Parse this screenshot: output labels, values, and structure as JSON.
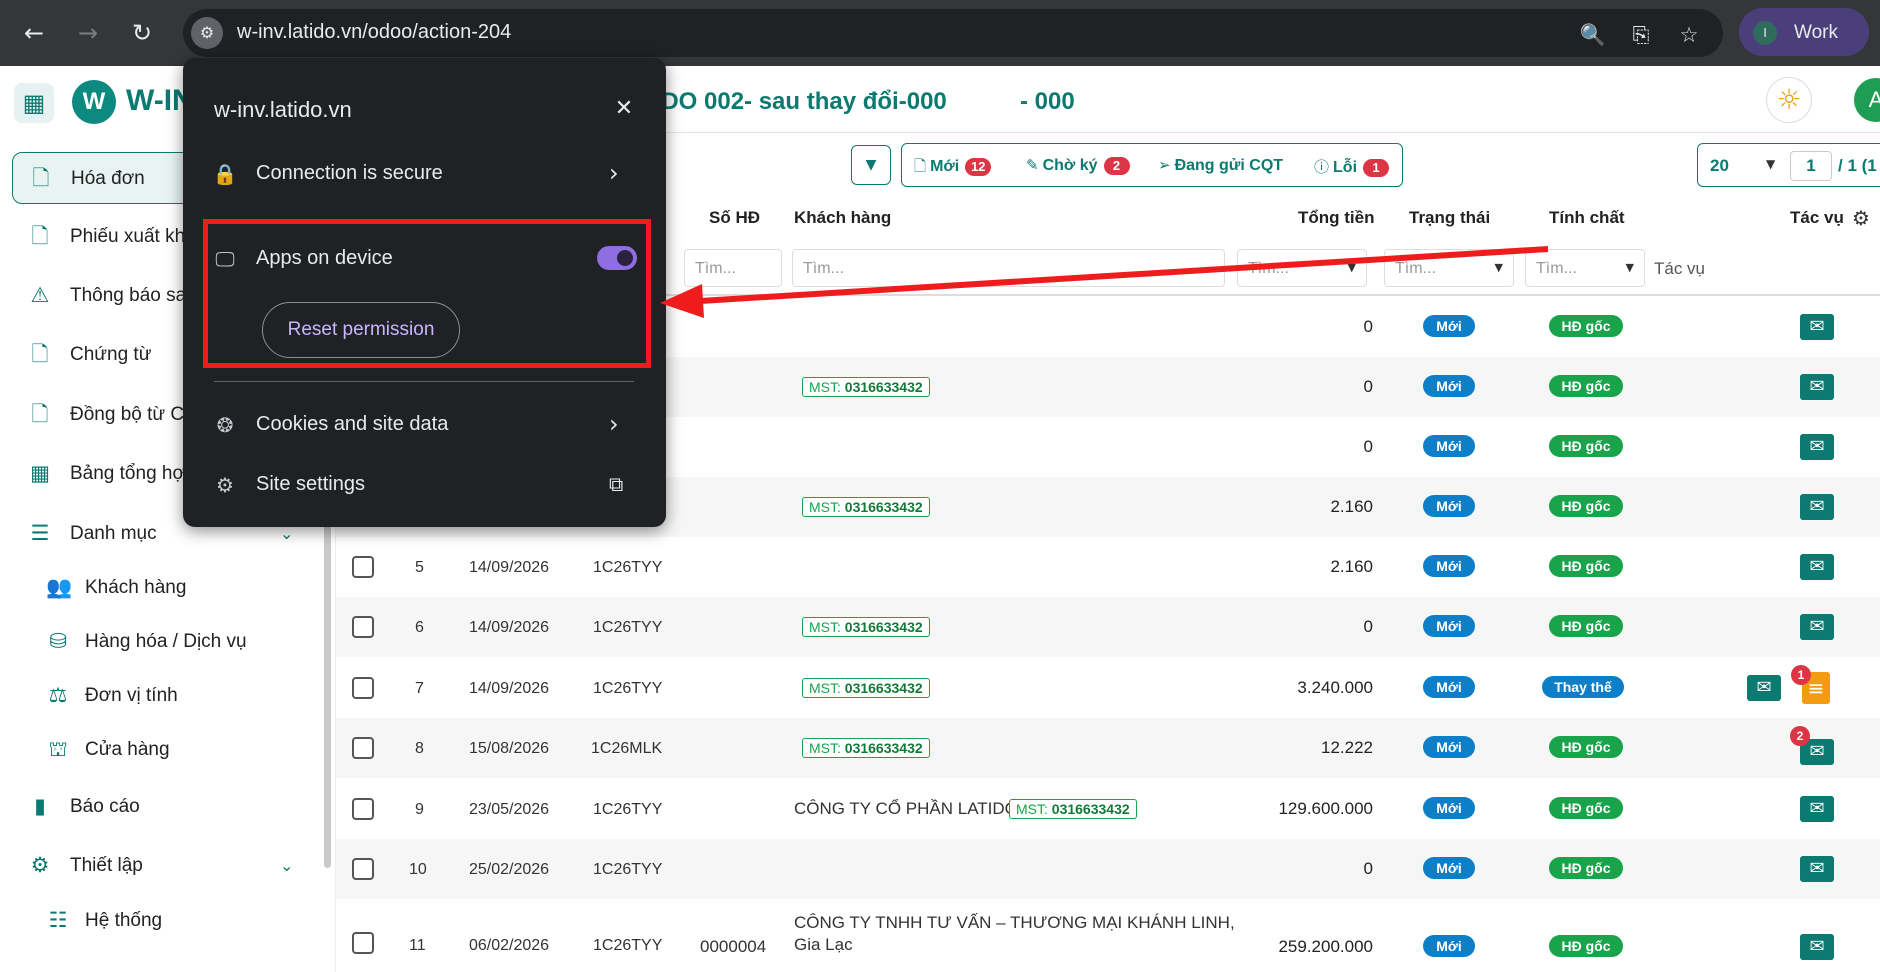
{
  "browser": {
    "url": "w-inv.latido.vn/odoo/action-204",
    "profile_initial": "I",
    "profile_label": "Work"
  },
  "app": {
    "brand": "W-IN",
    "document_title": "TIDO 002- sau thay đổi-000",
    "document_code": "- 000",
    "user_initial": "A"
  },
  "sidebar": {
    "items": [
      {
        "label": "Hóa đơn",
        "icon": "document-icon"
      },
      {
        "label": "Phiếu xuất kh",
        "icon": "document-icon"
      },
      {
        "label": "Thông báo sa",
        "icon": "warning-icon"
      },
      {
        "label": "Chứng từ",
        "icon": "document-icon"
      },
      {
        "label": "Đồng bộ từ C",
        "icon": "document-icon"
      },
      {
        "label": "Bảng tổng hợ",
        "icon": "table-icon"
      },
      {
        "label": "Danh mục",
        "icon": "list-icon"
      },
      {
        "label": "Khách hàng",
        "icon": "users-icon"
      },
      {
        "label": "Hàng hóa / Dịch vụ",
        "icon": "cubes-icon"
      },
      {
        "label": "Đơn vị tính",
        "icon": "scale-icon"
      },
      {
        "label": "Cửa hàng",
        "icon": "basket-icon"
      },
      {
        "label": "Báo cáo",
        "icon": "bar-chart-icon"
      },
      {
        "label": "Thiết lập",
        "icon": "gears-icon"
      },
      {
        "label": "Hệ thống",
        "icon": "sliders-icon"
      }
    ]
  },
  "filters": [
    {
      "label": "Mới",
      "count": "12"
    },
    {
      "label": "Chờ ký",
      "count": "2"
    },
    {
      "label": "Đang gửi CQT",
      "count": ""
    },
    {
      "label": "Lỗi",
      "count": "1"
    }
  ],
  "pager": {
    "size": "20",
    "page": "1",
    "total": "/ 1 (1"
  },
  "table": {
    "headers": {
      "invoice_no": "Số HĐ",
      "customer": "Khách hàng",
      "total": "Tổng tiền",
      "status": "Trạng thái",
      "nature": "Tính chất",
      "actions": "Tác vụ"
    },
    "search_placeholder": "Tìm...",
    "actions_filter_label": "Tác vụ",
    "rows": [
      {
        "no": "",
        "date": "",
        "series": "",
        "invoice_no": "",
        "customer": "",
        "mst": "",
        "total": "0",
        "status": "Mới",
        "nature": "HĐ gốc"
      },
      {
        "no": "",
        "date": "",
        "series": "",
        "invoice_no": "",
        "customer": "",
        "mst": "0316633432",
        "total": "0",
        "status": "Mới",
        "nature": "HĐ gốc"
      },
      {
        "no": "",
        "date": "",
        "series": "",
        "invoice_no": "",
        "customer": "",
        "mst": "",
        "total": "0",
        "status": "Mới",
        "nature": "HĐ gốc"
      },
      {
        "no": "",
        "date": "",
        "series": "",
        "invoice_no": "",
        "customer": "",
        "mst": "0316633432",
        "total": "2.160",
        "status": "Mới",
        "nature": "HĐ gốc"
      },
      {
        "no": "5",
        "date": "14/09/2026",
        "series": "1C26TYY",
        "invoice_no": "",
        "customer": "",
        "mst": "",
        "total": "2.160",
        "status": "Mới",
        "nature": "HĐ gốc"
      },
      {
        "no": "6",
        "date": "14/09/2026",
        "series": "1C26TYY",
        "invoice_no": "",
        "customer": "",
        "mst": "0316633432",
        "total": "0",
        "status": "Mới",
        "nature": "HĐ gốc"
      },
      {
        "no": "7",
        "date": "14/09/2026",
        "series": "1C26TYY",
        "invoice_no": "",
        "customer": "",
        "mst": "0316633432",
        "total": "3.240.000",
        "status": "Mới",
        "nature": "Thay thế",
        "doc_badge": "1"
      },
      {
        "no": "8",
        "date": "15/08/2026",
        "series": "1C26MLK",
        "invoice_no": "",
        "customer": "",
        "mst": "0316633432",
        "total": "12.222",
        "status": "Mới",
        "nature": "HĐ gốc",
        "mail_badge": "2"
      },
      {
        "no": "9",
        "date": "23/05/2026",
        "series": "1C26TYY",
        "invoice_no": "",
        "customer": "CÔNG TY CỔ PHẦN LATIDO",
        "mst": "0316633432",
        "total": "129.600.000",
        "status": "Mới",
        "nature": "HĐ gốc"
      },
      {
        "no": "10",
        "date": "25/02/2026",
        "series": "1C26TYY",
        "invoice_no": "",
        "customer": "",
        "mst": "",
        "total": "0",
        "status": "Mới",
        "nature": "HĐ gốc"
      },
      {
        "no": "11",
        "date": "06/02/2026",
        "series": "1C26TYY",
        "invoice_no": "0000004",
        "customer": "CÔNG TY TNHH TƯ VẤN – THƯƠNG MẠI KHÁNH LINH,",
        "customer_line2": "Gia Lạc",
        "mst": "",
        "total": "259.200.000",
        "status": "Mới",
        "nature": "HĐ gốc"
      }
    ],
    "mst_prefix": "MST:"
  },
  "popup": {
    "title": "w-inv.latido.vn",
    "connection": "Connection is secure",
    "apps": "Apps on device",
    "apps_enabled": true,
    "reset": "Reset permission",
    "cookies": "Cookies and site data",
    "settings": "Site settings"
  },
  "colors": {
    "brand": "#0c7a70",
    "status_new": "#0d7fc9",
    "nature_original": "#19a34a",
    "alert": "#dc3545",
    "annotation": "#ee1c1c"
  }
}
